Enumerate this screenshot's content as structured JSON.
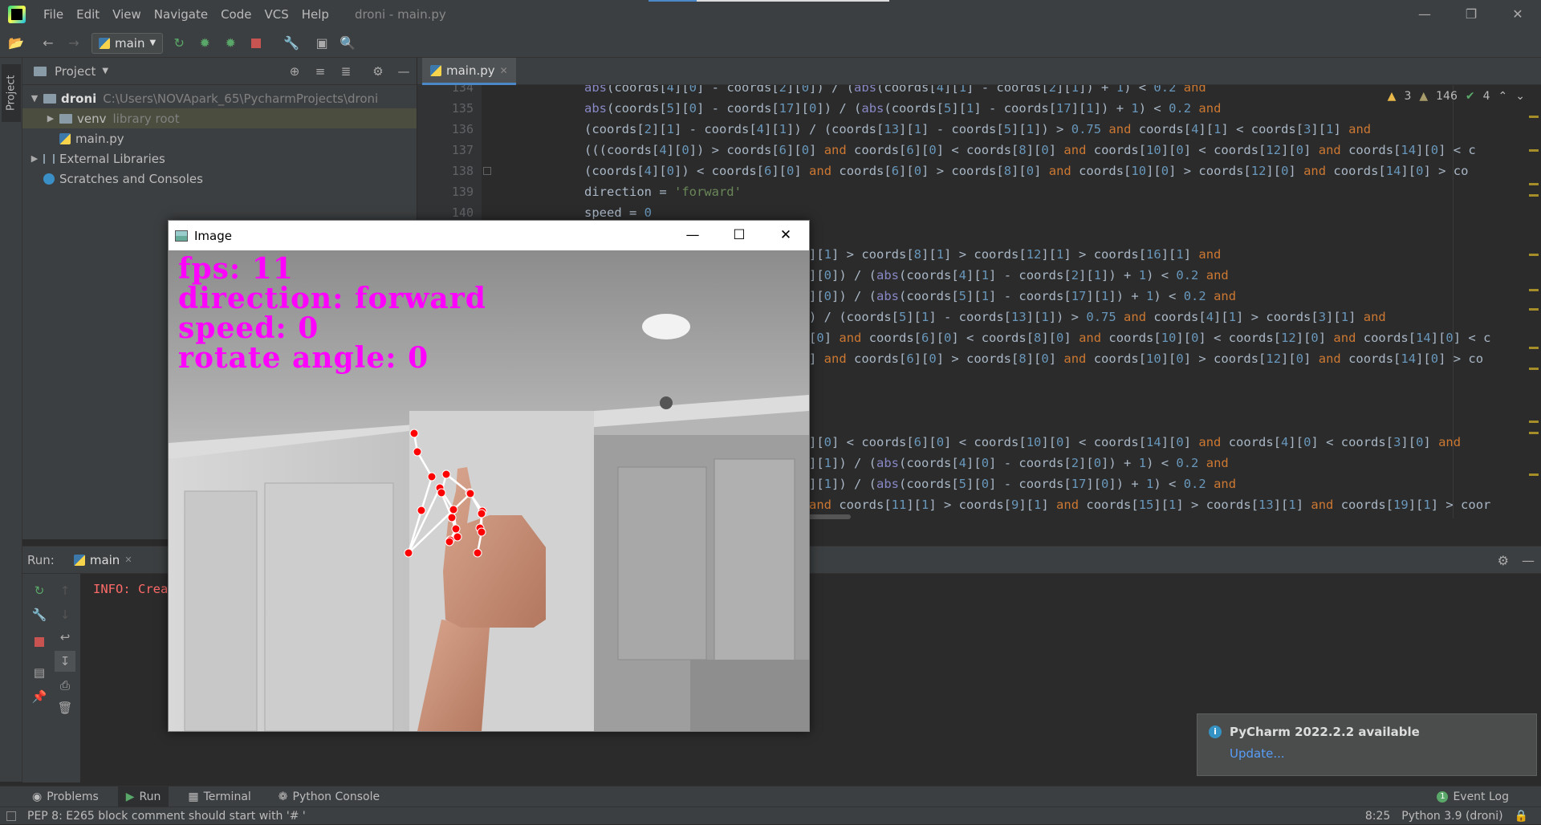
{
  "app": {
    "menu": [
      "File",
      "Edit",
      "View",
      "Navigate",
      "Code",
      "VCS",
      "Help"
    ],
    "window_title": "droni - main.py",
    "run_config": "main"
  },
  "project": {
    "title": "Project",
    "tree": [
      {
        "label": "droni",
        "path": "C:\\Users\\NOVApark_65\\PycharmProjects\\droni"
      },
      {
        "label": "venv",
        "hint": "library root"
      },
      {
        "label": "main.py"
      },
      {
        "label": "External Libraries"
      },
      {
        "label": "Scratches and Consoles"
      }
    ]
  },
  "left_stripe": {
    "project_tab": "Project"
  },
  "editor": {
    "tab": "main.py",
    "inspections": {
      "warnings": "3",
      "weak_warnings": "146",
      "typos": "4"
    },
    "line_numbers": [
      "134",
      "135",
      "136",
      "137",
      "138",
      "139",
      "140"
    ]
  },
  "image_window": {
    "title": "Image",
    "overlay": {
      "fps": "fps: 11",
      "direction": "direction: forward",
      "speed": "speed: 0",
      "rotate": "rotate angle: 0"
    }
  },
  "run": {
    "label": "Run:",
    "tab": "main",
    "console": "INFO: Crea"
  },
  "bottom_tabs": [
    "Problems",
    "Run",
    "Terminal",
    "Python Console"
  ],
  "event_log": "Event Log",
  "status": {
    "message": "PEP 8: E265 block comment should start with '# '",
    "position": "8:25",
    "interpreter": "Python 3.9 (droni)"
  },
  "notification": {
    "title": "PyCharm 2022.2.2 available",
    "link": "Update..."
  },
  "colors": {
    "overlay_text": "#ff00ff",
    "keyword": "#cc7832",
    "number": "#6897bb",
    "string": "#6a8759",
    "landmark": "#ff0000"
  }
}
